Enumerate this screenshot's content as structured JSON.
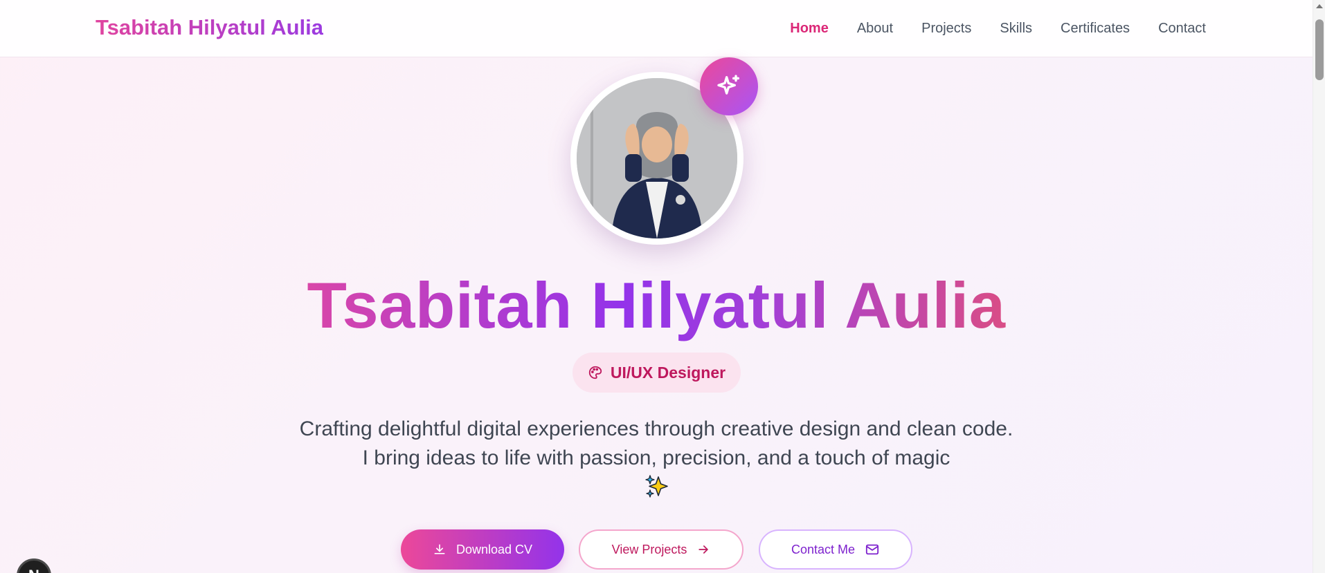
{
  "nav": {
    "brand": "Tsabitah Hilyatul Aulia",
    "links": [
      "Home",
      "About",
      "Projects",
      "Skills",
      "Certificates",
      "Contact"
    ],
    "active": "Home"
  },
  "hero": {
    "badge_icon": "sparkles-icon",
    "name": "Tsabitah Hilyatul Aulia",
    "role": "UI/UX Designer",
    "role_icon": "palette-icon",
    "tagline": "Crafting delightful digital experiences through creative design and clean code. I bring ideas to life with passion, precision, and a touch of magic",
    "tagline_emoji": "sparkles-emoji",
    "buttons": {
      "download": "Download CV",
      "projects": "View Projects",
      "contact": "Contact Me"
    }
  },
  "colors": {
    "accent_pink": "#ec4899",
    "accent_purple": "#9333ea",
    "active_link": "#db2777",
    "background": "#fbf2f8"
  },
  "corner_widget": {
    "letter": "N"
  }
}
